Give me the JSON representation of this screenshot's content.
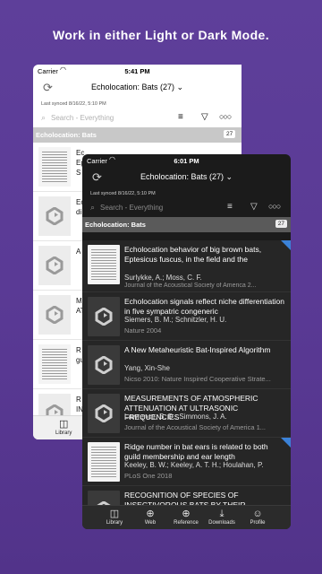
{
  "headline": "Work in either Light or Dark Mode.",
  "light": {
    "status": {
      "carrier": "Carrier",
      "time": "5:41 PM"
    },
    "nav_title": "Echolocation: Bats (27)",
    "synced": "Last synced 8/16/22, 5:10 PM",
    "search_placeholder": "Search - Everything",
    "collection": {
      "name": "Echolocation: Bats",
      "count": "27"
    },
    "snippets": [
      "Ec",
      "Ep",
      "S",
      "Ec",
      "di",
      "A",
      "M",
      "AT",
      "R",
      "gu",
      "R",
      "IN"
    ],
    "tab_library": "Library"
  },
  "dark": {
    "status": {
      "carrier": "Carrier",
      "time": "6:01 PM"
    },
    "nav_title": "Echolocation: Bats (27)",
    "synced": "Last synced 8/16/22, 5:10 PM",
    "search_placeholder": "Search - Everything",
    "collection": {
      "name": "Echolocation: Bats",
      "count": "27"
    },
    "rows": [
      {
        "title": "Echolocation behavior of big brown bats, Eptesicus fuscus, in the field and the",
        "authors": "Surlykke, A.; Moss, C. F.",
        "pub": "Journal of the Acoustical Society of America 2...",
        "thumb": "paper",
        "flag": true
      },
      {
        "title": "Echolocation signals reflect niche differentiation in five sympatric congeneric",
        "authors": "Siemers, B. M.; Schnitzler, H. U.",
        "pub": "Nature 2004",
        "thumb": "logo",
        "flag": false
      },
      {
        "title": "A New Metaheuristic Bat-Inspired Algorithm",
        "authors": "Yang, Xin-She",
        "pub": "Nicso 2010: Nature Inspired Cooperative Strate...",
        "thumb": "logo",
        "flag": false
      },
      {
        "title": "MEASUREMENTS OF ATMOSPHERIC ATTENUATION AT ULTRASONIC FREQUENCIES",
        "authors": "Lawrence, B. D.; Simmons, J. A.",
        "pub": "Journal of the Acoustical Society of America 1...",
        "thumb": "logo",
        "flag": false
      },
      {
        "title": "Ridge number in bat ears is related to both guild membership and ear length",
        "authors": "Keeley, B. W.; Keeley, A. T. H.; Houlahan, P.",
        "pub": "PLoS One 2018",
        "thumb": "paper",
        "flag": true
      },
      {
        "title": "RECOGNITION OF SPECIES OF INSECTIVOROUS BATS BY THEIR",
        "authors": "",
        "pub": "",
        "thumb": "logo",
        "flag": false
      }
    ],
    "tabs": [
      {
        "label": "Library",
        "icon": "library-icon",
        "glyph": "◫"
      },
      {
        "label": "Web",
        "icon": "globe-icon",
        "glyph": "⊕"
      },
      {
        "label": "Reference",
        "icon": "plus-circle-icon",
        "glyph": "⊕"
      },
      {
        "label": "Downloads",
        "icon": "download-icon",
        "glyph": "⤓"
      },
      {
        "label": "Profile",
        "icon": "profile-icon",
        "glyph": "☺"
      }
    ]
  },
  "colors": {
    "accent_blue": "#3b82d8",
    "background": "#5a3a95"
  }
}
